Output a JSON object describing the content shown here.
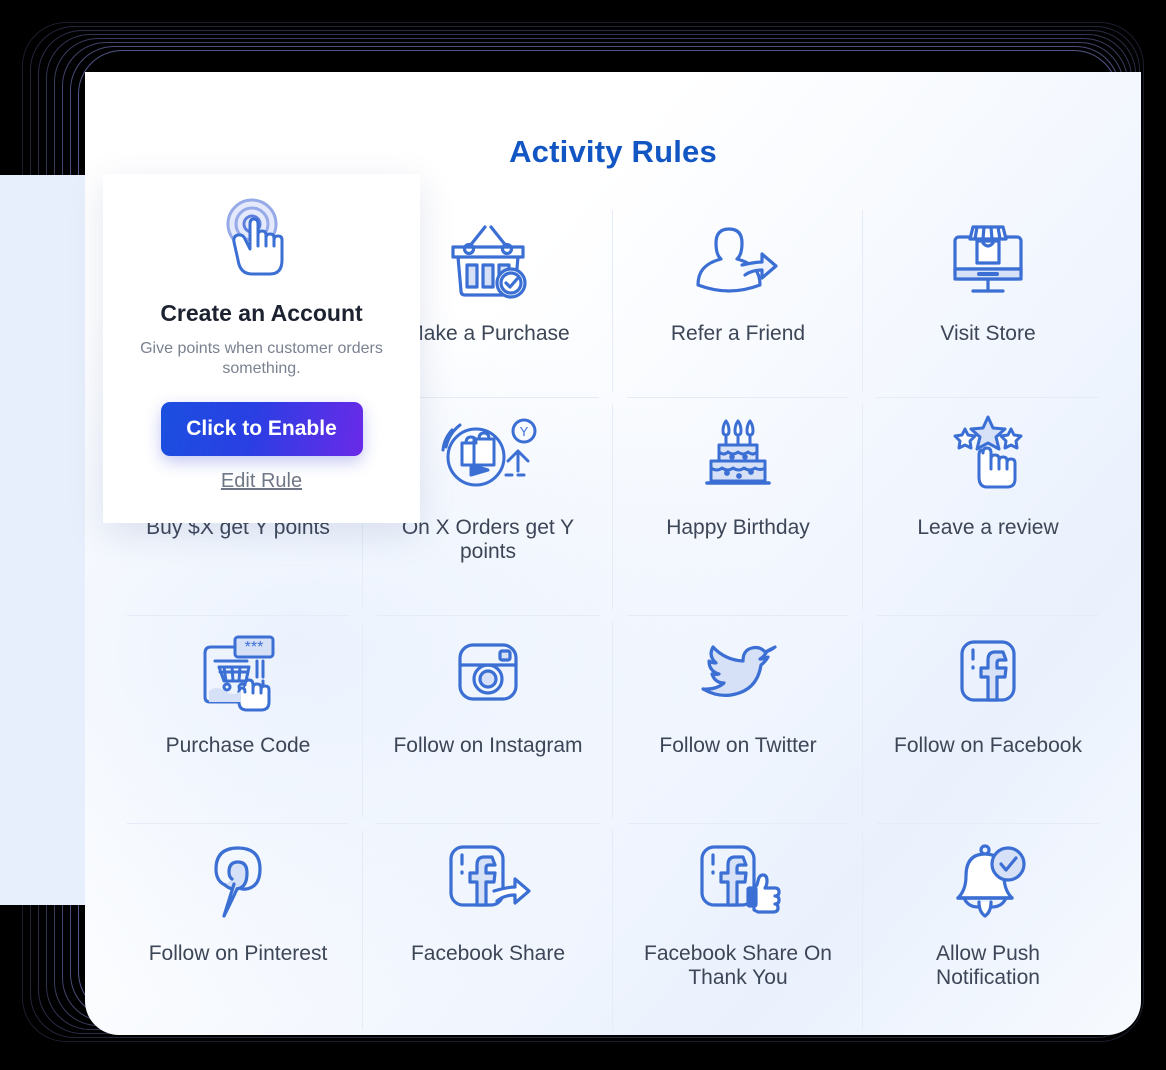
{
  "page": {
    "title": "Activity Rules",
    "accent_blue": "#1256c4",
    "icon_blue": "#3b6fd4",
    "icon_fill": "#d6e0f7",
    "label_color": "#3d4657",
    "divider_color": "#e4ecf7"
  },
  "popup": {
    "icon": "tap-hand-icon",
    "title": "Create an Account",
    "description": "Give points when customer orders something.",
    "enable_label": "Click to Enable",
    "edit_label": "Edit Rule",
    "button_gradient_from": "#1b4fe0",
    "button_gradient_to": "#6a2ae8"
  },
  "rules": [
    {
      "label": "Create an Account",
      "icon": "tap-hand-icon"
    },
    {
      "label": "Make a Purchase",
      "icon": "shopping-basket-check-icon"
    },
    {
      "label": "Refer a Friend",
      "icon": "person-share-icon"
    },
    {
      "label": "Visit Store",
      "icon": "store-monitor-icon"
    },
    {
      "label": "Buy $X get Y points",
      "icon": "money-points-icon"
    },
    {
      "label": "On X Orders get Y points",
      "icon": "orders-points-icon"
    },
    {
      "label": "Happy Birthday",
      "icon": "birthday-cake-icon"
    },
    {
      "label": "Leave a review",
      "icon": "stars-hand-icon"
    },
    {
      "label": "Purchase Code",
      "icon": "purchase-code-icon"
    },
    {
      "label": "Follow on Instagram",
      "icon": "instagram-icon"
    },
    {
      "label": "Follow on Twitter",
      "icon": "twitter-bird-icon"
    },
    {
      "label": "Follow on Facebook",
      "icon": "facebook-icon"
    },
    {
      "label": "Follow on Pinterest",
      "icon": "pinterest-icon"
    },
    {
      "label": "Facebook Share",
      "icon": "facebook-share-icon"
    },
    {
      "label": "Facebook Share On Thank You",
      "icon": "facebook-like-icon"
    },
    {
      "label": "Allow Push Notification",
      "icon": "bell-check-icon"
    }
  ]
}
